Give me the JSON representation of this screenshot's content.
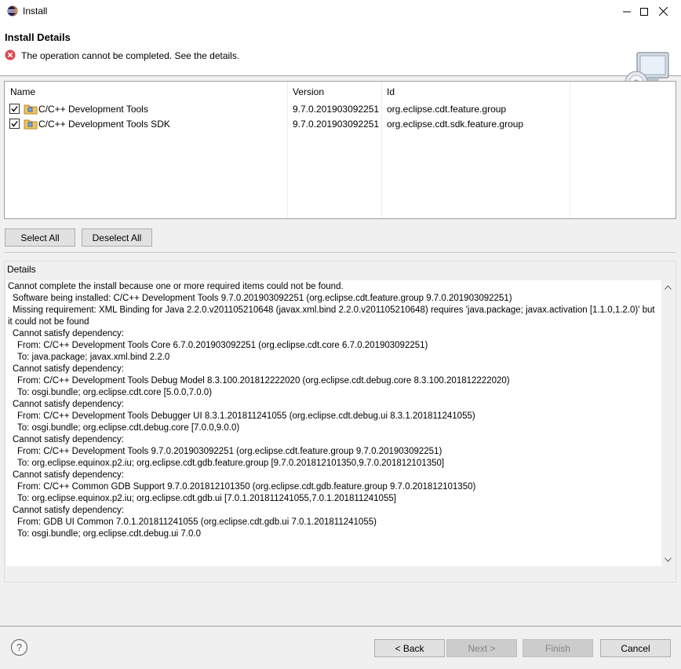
{
  "window": {
    "title": "Install"
  },
  "header": {
    "title": "Install Details",
    "message": "The operation cannot be completed.  See the details."
  },
  "table": {
    "columns": [
      "Name",
      "Version",
      "Id"
    ],
    "rows": [
      {
        "checked": true,
        "name": "C/C++ Development Tools",
        "version": "9.7.0.201903092251",
        "id": "org.eclipse.cdt.feature.group"
      },
      {
        "checked": true,
        "name": "C/C++ Development Tools SDK",
        "version": "9.7.0.201903092251",
        "id": "org.eclipse.cdt.sdk.feature.group"
      }
    ]
  },
  "buttons": {
    "select_all": "Select All",
    "deselect_all": "Deselect All",
    "back": "< Back",
    "next": "Next >",
    "finish": "Finish",
    "cancel": "Cancel"
  },
  "details": {
    "label": "Details",
    "lines": [
      "Cannot complete the install because one or more required items could not be found.",
      "  Software being installed: C/C++ Development Tools 9.7.0.201903092251 (org.eclipse.cdt.feature.group 9.7.0.201903092251)",
      "  Missing requirement: XML Binding for Java 2.2.0.v201105210648 (javax.xml.bind 2.2.0.v201105210648) requires 'java.package; javax.activation [1.1.0,1.2.0)' but",
      "it could not be found",
      "  Cannot satisfy dependency:",
      "    From: C/C++ Development Tools Core 6.7.0.201903092251 (org.eclipse.cdt.core 6.7.0.201903092251)",
      "    To: java.package; javax.xml.bind 2.2.0",
      "  Cannot satisfy dependency:",
      "    From: C/C++ Development Tools Debug Model 8.3.100.201812222020 (org.eclipse.cdt.debug.core 8.3.100.201812222020)",
      "    To: osgi.bundle; org.eclipse.cdt.core [5.0.0,7.0.0)",
      "  Cannot satisfy dependency:",
      "    From: C/C++ Development Tools Debugger UI 8.3.1.201811241055 (org.eclipse.cdt.debug.ui 8.3.1.201811241055)",
      "    To: osgi.bundle; org.eclipse.cdt.debug.core [7.0.0,9.0.0)",
      "  Cannot satisfy dependency:",
      "    From: C/C++ Development Tools 9.7.0.201903092251 (org.eclipse.cdt.feature.group 9.7.0.201903092251)",
      "    To: org.eclipse.equinox.p2.iu; org.eclipse.cdt.gdb.feature.group [9.7.0.201812101350,9.7.0.201812101350]",
      "  Cannot satisfy dependency:",
      "    From: C/C++ Common GDB Support 9.7.0.201812101350 (org.eclipse.cdt.gdb.feature.group 9.7.0.201812101350)",
      "    To: org.eclipse.equinox.p2.iu; org.eclipse.cdt.gdb.ui [7.0.1.201811241055,7.0.1.201811241055]",
      "  Cannot satisfy dependency:",
      "    From: GDB UI Common 7.0.1.201811241055 (org.eclipse.cdt.gdb.ui 7.0.1.201811241055)",
      "    To: osgi.bundle; org.eclipse.cdt.debug.ui 7.0.0"
    ]
  },
  "icons": {
    "app": "eclipse-icon",
    "error": "error-icon",
    "feature": "feature-icon",
    "wizard": "install-wizard-icon",
    "help": "help-icon"
  },
  "colors": {
    "error_red": "#e0454d",
    "window_bg": "#f0f0f0"
  }
}
